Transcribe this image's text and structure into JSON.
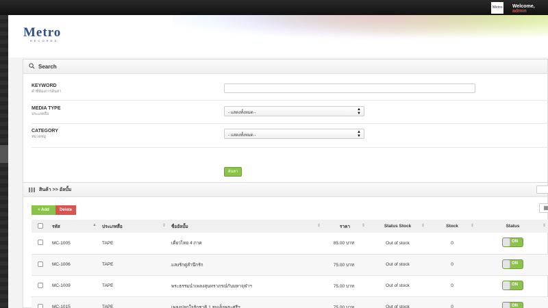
{
  "topbar": {
    "logo_text": "Metro",
    "welcome": "Welcome,",
    "user": "admin"
  },
  "brand": {
    "name": "Metro",
    "sub": "RECORDS"
  },
  "search": {
    "title": "Search",
    "keyword_label": "KEYWORD",
    "keyword_sub": "คำที่ต้องการค้นหา",
    "keyword_value": "",
    "media_label": "MEDIA TYPE",
    "media_sub": "ประเภทสื่อ",
    "media_value": "- แสดงทั้งหมด -",
    "category_label": "CATEGORY",
    "category_sub": "หมวดหมู่",
    "category_value": "- แสดงทั้งหมด -",
    "button": "ค้นหา"
  },
  "list": {
    "title": "สินค้า >> อัลบั้ม",
    "add": "Add",
    "delete": "Delete",
    "columns": [
      "รหัส",
      "ประเภทสื่อ",
      "ชื่ออัลบั้ม",
      "ราคา",
      "Status Stock",
      "Stock",
      "Status"
    ],
    "rows": [
      {
        "code": "MC-1005",
        "media": "TAPE",
        "album": "เดี่ยวไทย 4 ภาค",
        "price": "85.00 บาท",
        "status_stock": "Out of stock",
        "stock": "0",
        "status": "ON"
      },
      {
        "code": "MC-1006",
        "media": "TAPE",
        "album": "แสงรักคู่สำนึกรัก",
        "price": "75.00 บาท",
        "status_stock": "Out of stock",
        "stock": "0",
        "status": "ON"
      },
      {
        "code": "MC-1009",
        "media": "TAPE",
        "album": "พระธรรมนำเพลงสุนทราภรณ์กับมหาจุฬาฯ",
        "price": "75.00 บาท",
        "status_stock": "Out of stock",
        "stock": "0",
        "status": "ON"
      },
      {
        "code": "MC-1015",
        "media": "TAPE",
        "album": "เพลงปลุกใจรักชาติ 1 สมเด็จพระศรีฯ",
        "price": "75.00 บาท",
        "status_stock": "Out of stock",
        "stock": "0",
        "status": "ON"
      }
    ]
  },
  "colors": {
    "accent": "#8bc34a",
    "danger": "#d9534f",
    "brand": "#2f4e8c"
  }
}
